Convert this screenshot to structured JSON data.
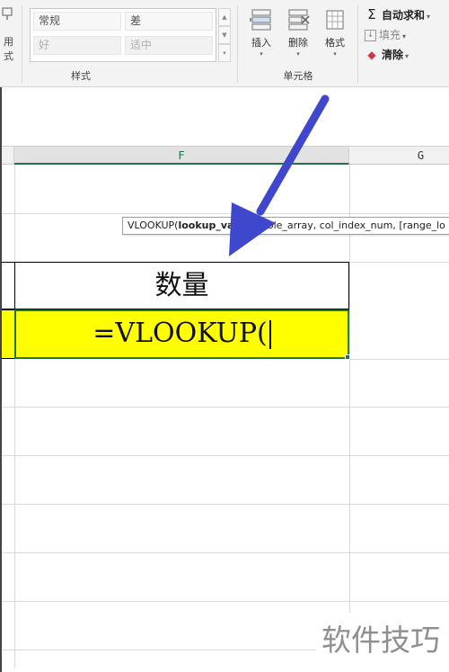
{
  "ribbon": {
    "partial_button_label_1": "用",
    "partial_button_label_2": "式",
    "styles": {
      "group_label": "样式",
      "cells": [
        {
          "label": "常规"
        },
        {
          "label": "差"
        },
        {
          "label": "好"
        },
        {
          "label": "适中"
        }
      ]
    },
    "cells_group": {
      "group_label": "单元格",
      "insert_label": "插入",
      "delete_label": "删除",
      "format_label": "格式"
    },
    "editing": {
      "autosum_label": "自动求和",
      "fill_label": "填充",
      "clear_label": "清除"
    }
  },
  "grid": {
    "columns": [
      {
        "label": "F"
      },
      {
        "label": "G"
      }
    ],
    "header_cell": "数量",
    "active_cell_formula": "=VLOOKUP(",
    "tooltip": {
      "function_name": "VLOOKUP(",
      "current_arg": "lookup_value",
      "rest": ", table_array, col_index_num, [range_lo"
    }
  },
  "watermark": "软件技巧",
  "colors": {
    "arrow": "#3f48cc",
    "active_fill": "#ffff00",
    "excel_green": "#217346"
  }
}
